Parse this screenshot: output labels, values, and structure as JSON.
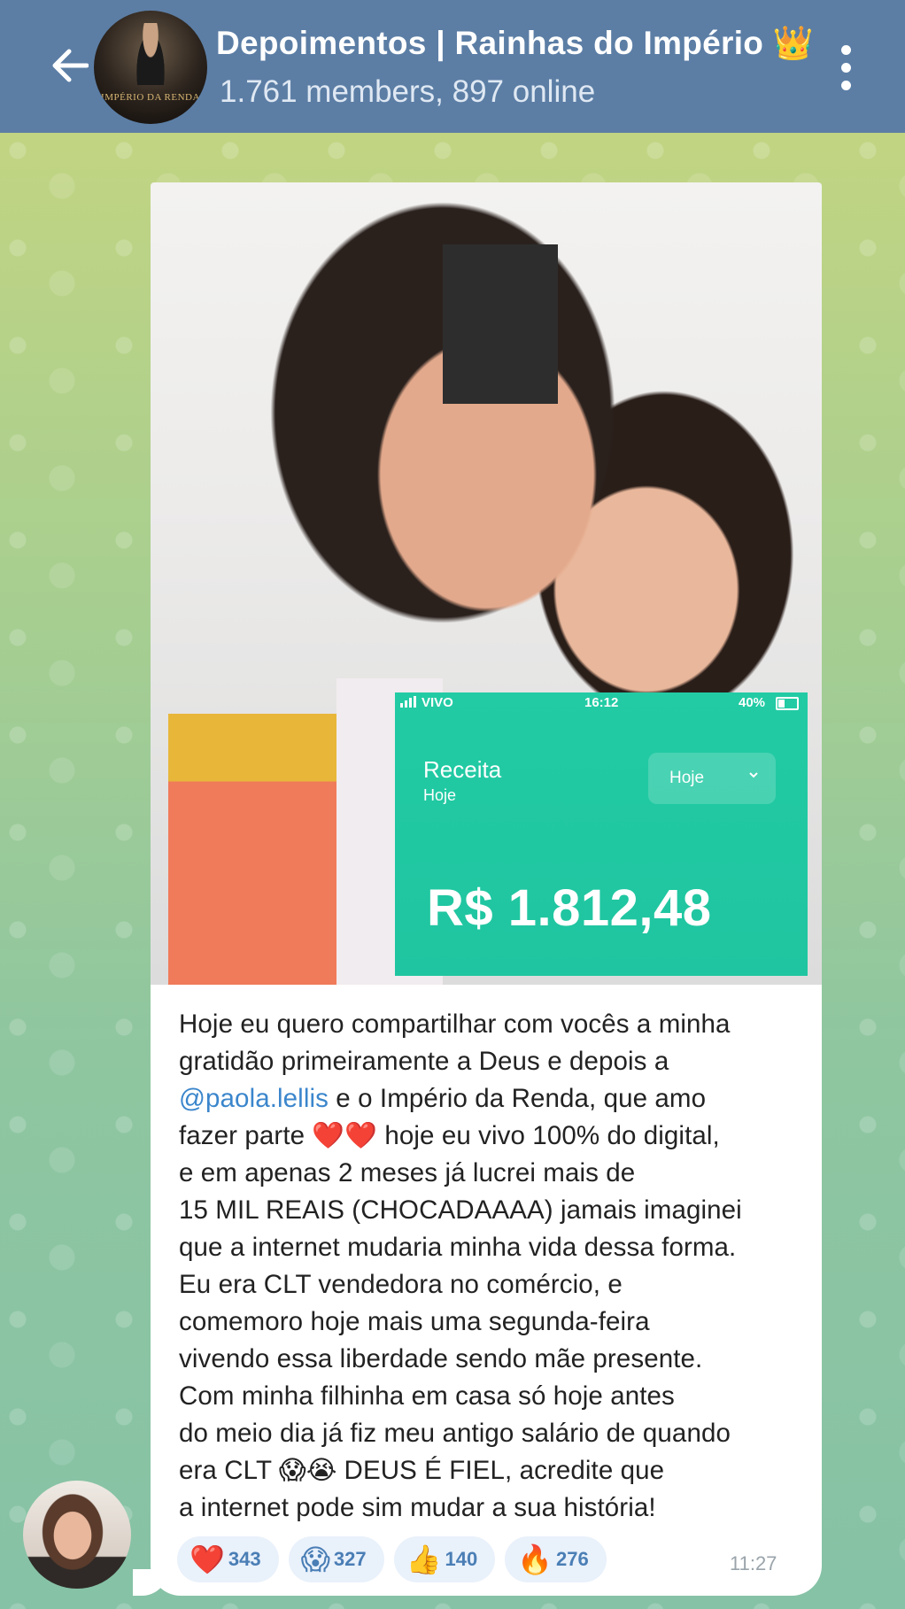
{
  "header": {
    "back_icon": "arrow-left-icon",
    "title": "Depoimentos | Rainhas do Império 👑",
    "subtitle": "1.761 members, 897 online",
    "menu_icon": "more-vertical-icon",
    "avatar_text": "IMPÉRIO DA RENDA"
  },
  "photo": {
    "status_carrier": "VIVO",
    "status_time": "16:12",
    "status_battery": "40%",
    "card_title": "Receita",
    "card_subtitle": "Hoje",
    "period_value": "Hoje",
    "amount": "R$ 1.812,48"
  },
  "message": {
    "lines": [
      "Hoje eu quero compartilhar com vocês a minha",
      "gratidão primeiramente a Deus e depois a",
      "",
      "fazer parte ❤️❤️ hoje eu vivo 100% do digital,",
      "e em apenas 2 meses já lucrei mais de",
      "15 MIL REAIS (CHOCADAAAA) jamais imaginei",
      "que a internet mudaria minha vida dessa forma.",
      "Eu era CLT vendedora no comércio, e",
      "comemoro hoje mais uma segunda-feira",
      "vivendo essa liberdade sendo mãe presente.",
      "Com minha filhinha em casa só hoje antes",
      "do meio dia já fiz meu antigo salário de quando",
      "era CLT 😱😭 DEUS É FIEL, acredite que",
      "a internet pode sim mudar a sua história!"
    ],
    "mention": "@paola.lellis",
    "mention_rest": " e o Império da Renda, que amo",
    "time": "11:27"
  },
  "reactions": [
    {
      "emoji": "❤️",
      "count": "343"
    },
    {
      "emoji": "😱",
      "count": "327"
    },
    {
      "emoji": "👍",
      "count": "140"
    },
    {
      "emoji": "🔥",
      "count": "276"
    }
  ],
  "colors": {
    "header_bg": "#5c7ea5",
    "card_bg": "#22cba4",
    "link": "#3b86cc",
    "reaction_bg": "#e9f1fb",
    "reaction_text": "#4a7eb5"
  }
}
